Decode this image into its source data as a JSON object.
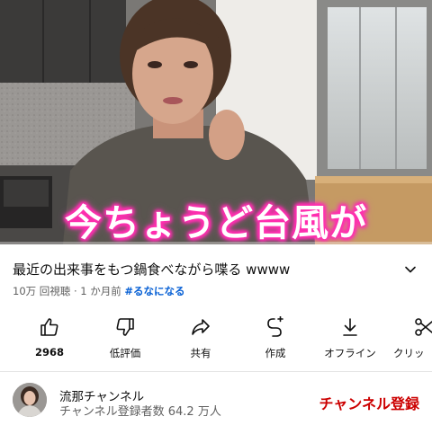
{
  "video": {
    "caption": "今ちょうど台風が",
    "progress": 0.0
  },
  "details": {
    "title": "最近の出来事をもつ鍋食べながら喋る wwww",
    "views": "10万 回視聴",
    "age": "1 か月前",
    "hashtag": "#るなになる"
  },
  "actions": {
    "like": "2968",
    "dislike": "低評価",
    "share": "共有",
    "remix": "作成",
    "offline": "オフライン",
    "clip": "クリッ"
  },
  "channel": {
    "name": "流那チャンネル",
    "subscribers": "チャンネル登録者数 64.2 万人",
    "subscribe_label": "チャンネル登録"
  },
  "colors": {
    "accent": "#cc0000",
    "link": "#065fd4",
    "caption_glow": "#ff2fb0"
  }
}
